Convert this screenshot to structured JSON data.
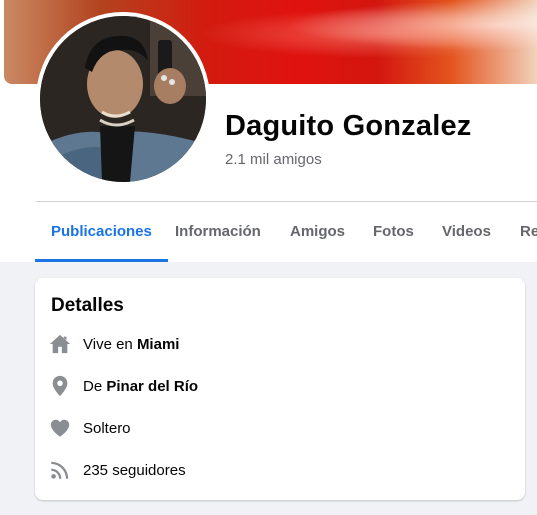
{
  "profile": {
    "name": "Daguito Gonzalez",
    "friends": "2.1 mil amigos"
  },
  "tabs": [
    {
      "label": "Publicaciones",
      "active": true
    },
    {
      "label": "Información",
      "active": false
    },
    {
      "label": "Amigos",
      "active": false
    },
    {
      "label": "Fotos",
      "active": false
    },
    {
      "label": "Videos",
      "active": false
    },
    {
      "label": "Re",
      "active": false
    }
  ],
  "details": {
    "title": "Detalles",
    "rows": [
      {
        "icon": "home-icon",
        "prefix": "Vive en",
        "value": "Miami"
      },
      {
        "icon": "location-pin-icon",
        "prefix": "De",
        "value": "Pinar del Río"
      },
      {
        "icon": "heart-icon",
        "prefix": "",
        "value": "Soltero"
      },
      {
        "icon": "rss-feed-icon",
        "prefix": "",
        "value": "235 seguidores"
      }
    ]
  },
  "colors": {
    "accent": "#1b74e4",
    "secondary_text": "#65676b",
    "background": "#f0f2f5"
  }
}
